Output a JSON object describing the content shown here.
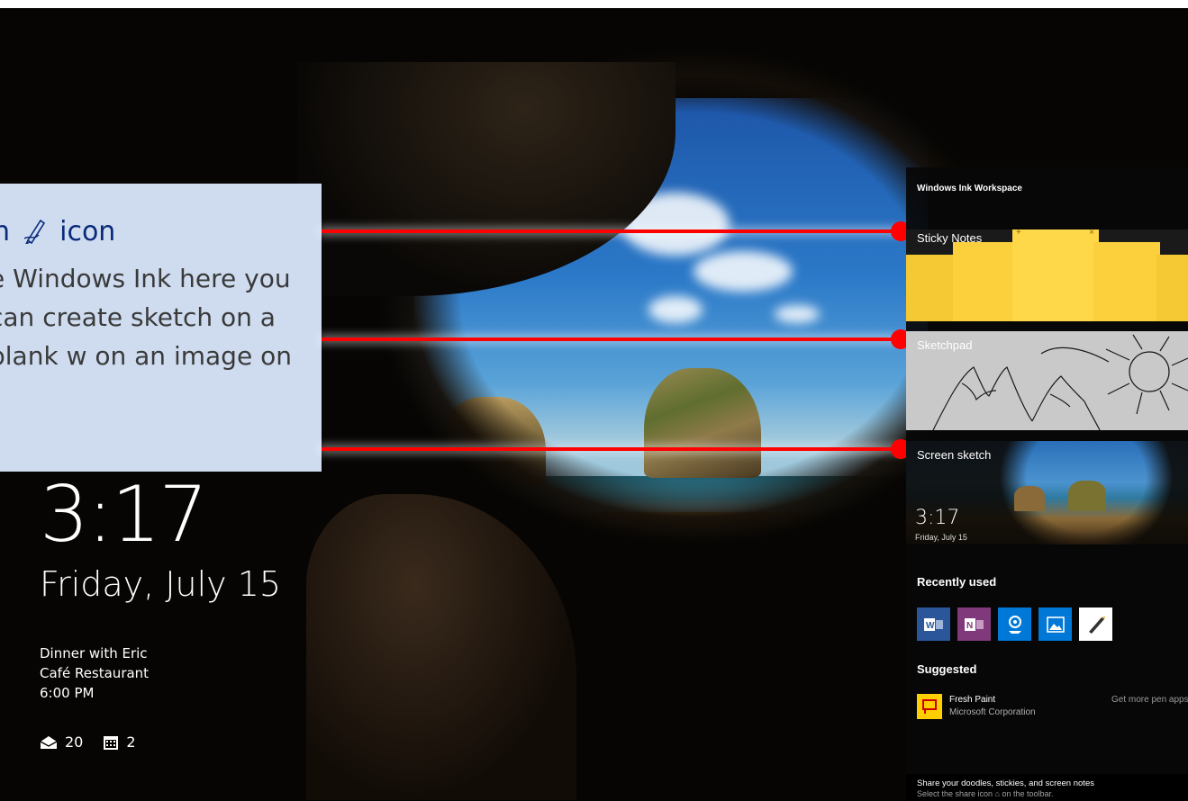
{
  "callout": {
    "heading_prefix": "n",
    "heading_suffix": "icon",
    "body": "e Windows Ink here you can create sketch on a blank w on an image on"
  },
  "lock_screen": {
    "time": "3:17",
    "date": "Friday, July 15",
    "event_title": "Dinner with Eric",
    "event_location": "Café Restaurant",
    "event_time": "6:00 PM",
    "mail_count": "20",
    "calendar_count": "2"
  },
  "workspace": {
    "title": "Windows Ink Workspace",
    "sticky_notes": "Sticky Notes",
    "sketchpad": "Sketchpad",
    "screen_sketch": "Screen sketch",
    "preview_time": "3:17",
    "preview_date": "Friday, July 15",
    "recently_used": "Recently used",
    "apps": [
      {
        "name": "word-icon",
        "color": "#2b579a",
        "glyph": "W"
      },
      {
        "name": "onenote-icon",
        "color": "#80397b",
        "glyph": "N"
      },
      {
        "name": "maps-icon",
        "color": "#0078d7",
        "glyph": "◉"
      },
      {
        "name": "photos-icon",
        "color": "#0078d7",
        "glyph": "▲"
      },
      {
        "name": "pen-app-icon",
        "color": "#ffffff",
        "glyph": "✒"
      }
    ],
    "suggested": "Suggested",
    "suggested_app": {
      "name": "Fresh Paint",
      "publisher": "Microsoft Corporation",
      "more_link": "Get more pen apps"
    },
    "footer_main": "Share your doodles, stickies, and screen notes",
    "footer_sub": "Select the share icon ⌂ on the toolbar."
  },
  "colors": {
    "callout_bg": "#cfdcf0",
    "callout_heading": "#0a2a7a",
    "pointer": "#ff0000",
    "sticky": "#ffd43f"
  }
}
